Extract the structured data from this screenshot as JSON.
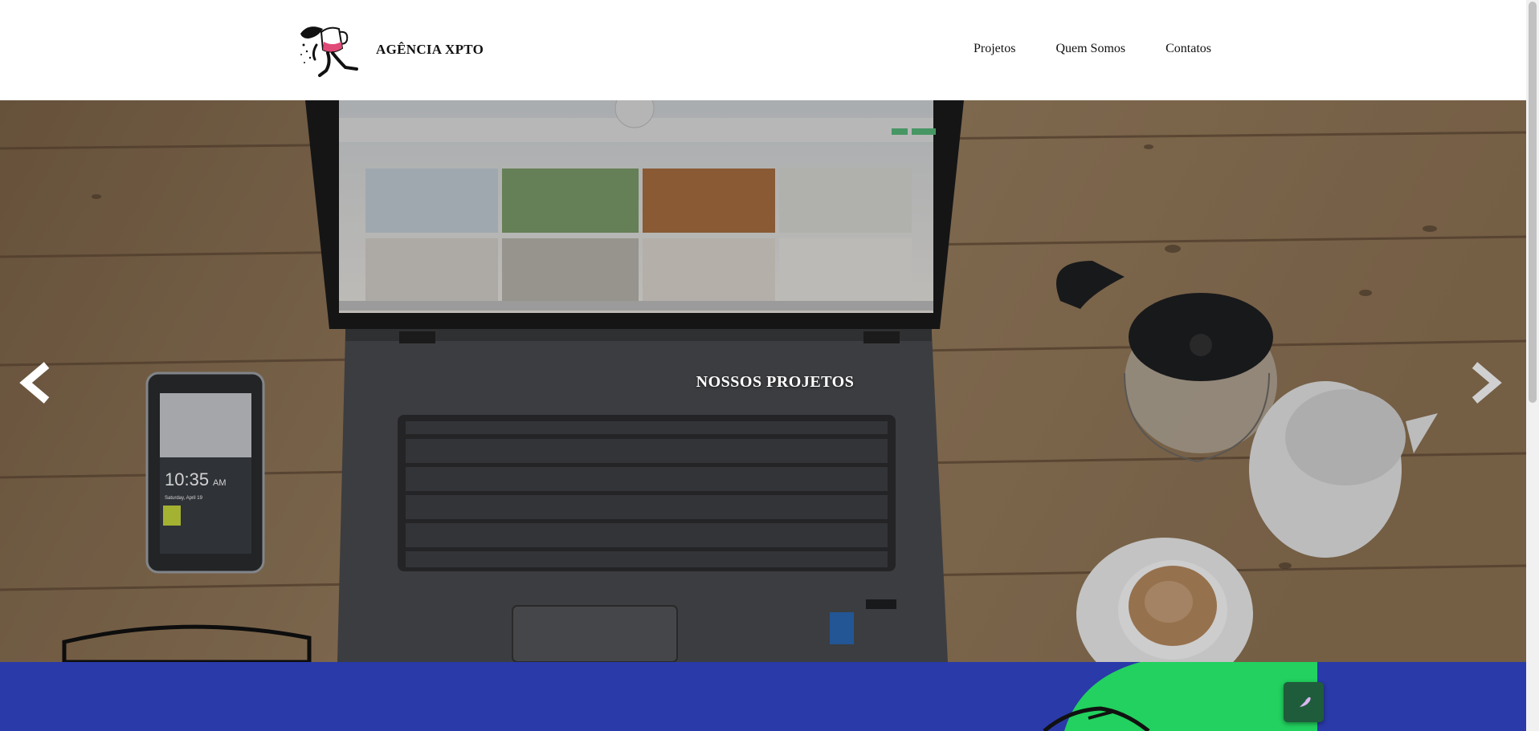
{
  "header": {
    "brand": "AGÊNCIA XPTO",
    "logo_icon": "running-person-with-cup-logo",
    "nav": [
      {
        "label": "Projetos"
      },
      {
        "label": "Quem Somos"
      },
      {
        "label": "Contatos"
      }
    ]
  },
  "hero": {
    "caption": "NOSSOS PROJETOS",
    "prev_icon": "chevron-left-icon",
    "next_icon": "chevron-right-icon",
    "phone_time": "10:35",
    "phone_ampm": "AM",
    "phone_date": "Saturday, April 19"
  },
  "colors": {
    "blue_section": "#2a3aa8",
    "green_shape": "#22d15f",
    "float_button": "#1f5c3c"
  },
  "float_button": {
    "icon": "feather-icon"
  }
}
